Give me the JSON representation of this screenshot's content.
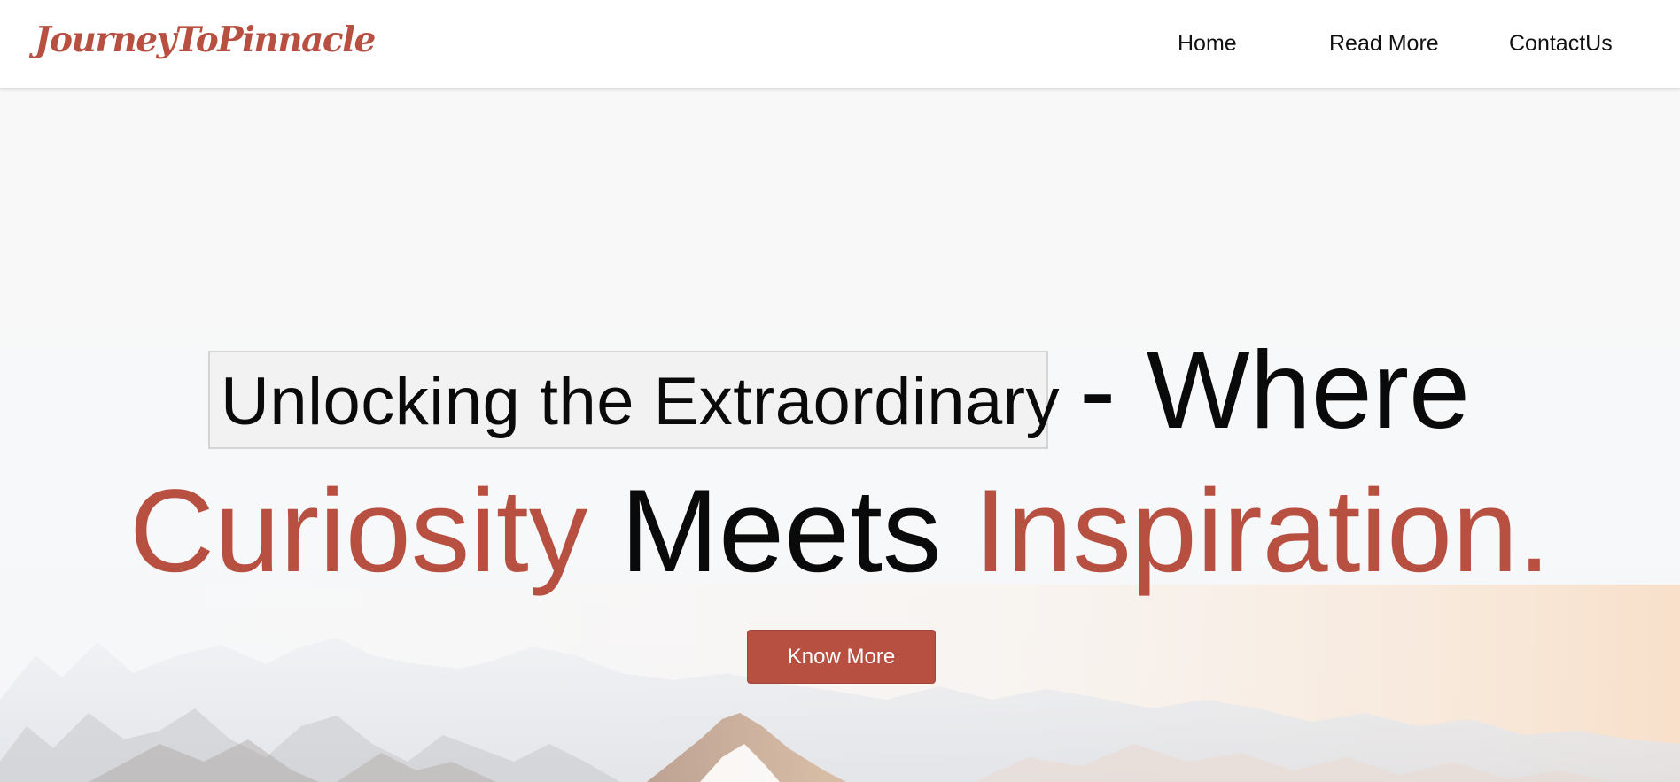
{
  "brand": {
    "name": "JourneyToPinnacle"
  },
  "nav": {
    "home": "Home",
    "read_more": "Read More",
    "contact": "ContactUs"
  },
  "hero": {
    "highlight": "Unlocking the Extraordinary",
    "line1_rest": "- Where",
    "word_curiosity": "Curiosity",
    "word_meets": "Meets",
    "word_inspiration": "Inspiration.",
    "cta_label": "Know More"
  },
  "colors": {
    "accent": "#b85042",
    "text": "#0a0a0a",
    "nav_bg": "#ffffff",
    "highlight_bg": "#f2f2f2"
  }
}
